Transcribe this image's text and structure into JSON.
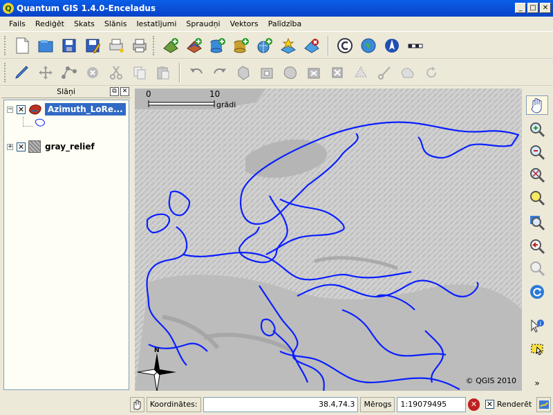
{
  "window": {
    "title": "Quantum GIS 1.4.0-Enceladus",
    "app_icon": "Q"
  },
  "menu": [
    "Fails",
    "Rediģēt",
    "Skats",
    "Slānis",
    "Iestatījumi",
    "Spraudņi",
    "Vektors",
    "Palīdzība"
  ],
  "panel": {
    "title": "Slāņi"
  },
  "layers": [
    {
      "name": "Azimuth_LoRe...",
      "checked": true,
      "selected": true,
      "icon": "vector-polygon-layer-icon"
    },
    {
      "name": "gray_relief",
      "checked": true,
      "selected": false,
      "icon": "raster-layer-icon"
    }
  ],
  "map": {
    "scalebar": {
      "start": "0",
      "end": "10",
      "unit": "grādi"
    },
    "copyright": "© QGIS 2010",
    "north_arrow_label": "N",
    "colors": {
      "boundary": "#0a20ff",
      "relief": "#c4c4c4"
    }
  },
  "status": {
    "coord_label": "Koordinātes:",
    "coord_value": "38.4,74.3",
    "scale_label": "Mērogs",
    "scale_value": "1:19079495",
    "render_label": "Renderēt"
  }
}
